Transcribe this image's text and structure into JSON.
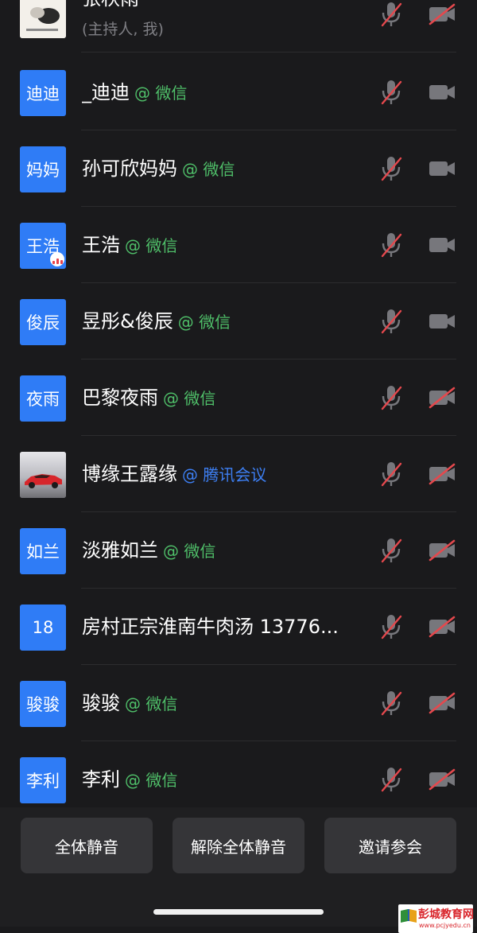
{
  "participants": [
    {
      "avatar_text": "",
      "name": "张秋雨",
      "source": "",
      "sub": "(主持人, 我)",
      "avatar_kind": "photo-host",
      "cam_off": true
    },
    {
      "avatar_text": "迪迪",
      "name": "_迪迪",
      "source": "@ 微信",
      "source_color": "#4fbf69",
      "cam_off": false
    },
    {
      "avatar_text": "妈妈",
      "name": "孙可欣妈妈",
      "source": "@ 微信",
      "source_color": "#4fbf69",
      "cam_off": false
    },
    {
      "avatar_text": "王浩",
      "name": "王浩",
      "source": "@ 微信",
      "source_color": "#4fbf69",
      "cam_off": false,
      "speaking": true
    },
    {
      "avatar_text": "俊辰",
      "name": "昱彤&俊辰",
      "source": "@ 微信",
      "source_color": "#4fbf69",
      "cam_off": false
    },
    {
      "avatar_text": "夜雨",
      "name": "巴黎夜雨",
      "source": "@ 微信",
      "source_color": "#4fbf69",
      "cam_off": true
    },
    {
      "avatar_text": "",
      "name": "博缘王露缘",
      "source": "@ 腾讯会议",
      "source_color": "#3d7ff3",
      "avatar_kind": "photo-car",
      "cam_off": true
    },
    {
      "avatar_text": "如兰",
      "name": "淡雅如兰",
      "source": "@ 微信",
      "source_color": "#4fbf69",
      "cam_off": true
    },
    {
      "avatar_text": "18",
      "name": "房村正宗淮南牛肉汤 13776...",
      "source": "",
      "cam_off": true
    },
    {
      "avatar_text": "骏骏",
      "name": "骏骏",
      "source": "@ 微信",
      "source_color": "#4fbf69",
      "cam_off": true
    },
    {
      "avatar_text": "李利",
      "name": "李利",
      "source": "@ 微信",
      "source_color": "#4fbf69",
      "cam_off": true
    }
  ],
  "toolbar": {
    "mute_all": "全体静音",
    "unmute_all": "解除全体静音",
    "invite": "邀请参会"
  },
  "watermark": {
    "title": "彭城教育网",
    "url": "www.pcjyedu.cn"
  }
}
